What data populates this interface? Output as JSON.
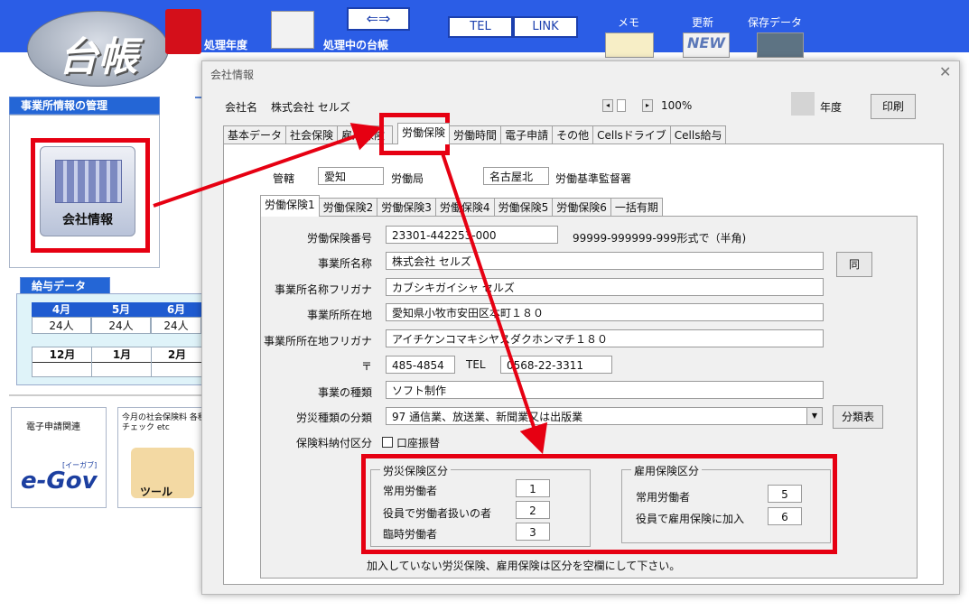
{
  "app": {
    "logo_text": "台帳",
    "toolbar": {
      "year_label": "処理年度",
      "ledger_label": "処理中の台帳",
      "tel": "TEL",
      "link": "LINK",
      "memo": "メモ",
      "update": "更新",
      "saved_data": "保存データ",
      "new_badge": "NEW"
    },
    "sidebar": {
      "office_mgmt": "事業所情報の管理",
      "company_info": "会社情報",
      "payroll_title": "給与データ",
      "months_row1": [
        "4月",
        "5月",
        "6月"
      ],
      "counts_row1": [
        "24人",
        "24人",
        "24人"
      ],
      "months_row2": [
        "12月",
        "1月",
        "2月"
      ],
      "denshi": "電子申請関連",
      "egov": "e-Gov",
      "egov_ruby": "[イーガブ]",
      "monthly_check": "今月の社会保険料 各種チェック etc",
      "tool": "ツール"
    }
  },
  "dialog": {
    "title": "会社情報",
    "company_label": "会社名",
    "company_name": "株式会社 セルズ",
    "zoom": "100%",
    "year_label": "年度",
    "print": "印刷",
    "tabs": [
      "基本データ",
      "社会保険",
      "雇用保険",
      "労働保険",
      "労働時間",
      "電子申請",
      "その他",
      "Cellsドライブ",
      "Cells給与"
    ],
    "jurisdiction": {
      "label": "管轄",
      "pref": "愛知",
      "bureau": "労働局",
      "office": "名古屋北",
      "office_suffix": "労働基準監督署"
    },
    "subtabs": [
      "労働保険1",
      "労働保険2",
      "労働保険3",
      "労働保険4",
      "労働保険5",
      "労働保険6",
      "一括有期"
    ],
    "form": {
      "insurance_no_label": "労働保険番号",
      "insurance_no": "23301-442253-000",
      "insurance_no_hint": "99999-999999-999形式で（半角)",
      "office_name_label": "事業所名称",
      "office_name": "株式会社 セルズ",
      "same_button": "同",
      "office_kana_label": "事業所名称フリガナ",
      "office_kana": "カブシキガイシャ セルズ",
      "address_label": "事業所所在地",
      "address": "愛知県小牧市安田区本町１８０",
      "address_kana_label": "事業所所在地フリガナ",
      "address_kana": "アイチケンコマキシヤスダクホンマチ１８０",
      "zip_label": "〒",
      "zip": "485-4854",
      "tel_label": "TEL",
      "tel": "0568-22-3311",
      "business_type_label": "事業の種類",
      "business_type": "ソフト制作",
      "industry_label": "労災種類の分類",
      "industry": "97 通信業、放送業、新聞業又は出版業",
      "classification_button": "分類表",
      "payment_label": "保険料納付区分",
      "payment_option": "口座振替"
    },
    "rousai": {
      "title": "労災保険区分",
      "rows": [
        {
          "label": "常用労働者",
          "value": "1"
        },
        {
          "label": "役員で労働者扱いの者",
          "value": "2"
        },
        {
          "label": "臨時労働者",
          "value": "3"
        }
      ]
    },
    "koyou": {
      "title": "雇用保険区分",
      "rows": [
        {
          "label": "常用労働者",
          "value": "5"
        },
        {
          "label": "役員で雇用保険に加入",
          "value": "6"
        }
      ]
    },
    "footer_note": "加入していない労災保険、雇用保険は区分を空欄にして下さい。"
  },
  "colors": {
    "accent": "#2b5de6",
    "highlight": "#e60012",
    "dialog_bg": "#f0f0f0"
  }
}
